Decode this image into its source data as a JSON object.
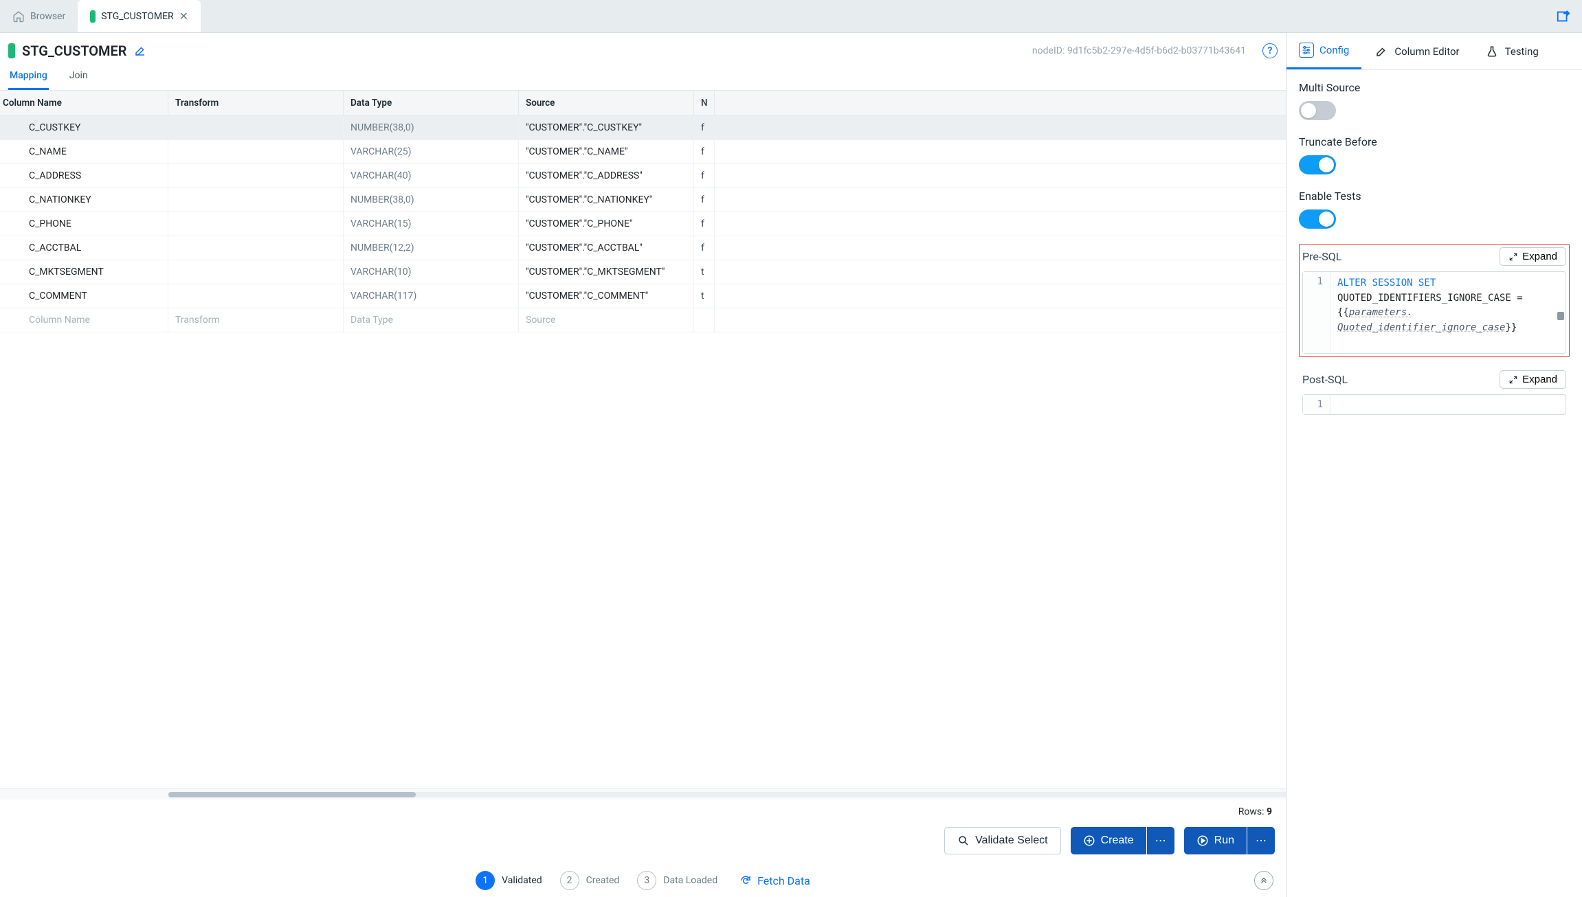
{
  "tabs": {
    "browser": "Browser",
    "node_tab": "STG_CUSTOMER"
  },
  "node": {
    "title": "STG_CUSTOMER",
    "id_label": "nodeID:",
    "id_value": "9d1fc5b2-297e-4d5f-b6d2-b03771b43641"
  },
  "subtabs": {
    "mapping": "Mapping",
    "join": "Join"
  },
  "grid": {
    "headers": {
      "name": "Column Name",
      "transform": "Transform",
      "type": "Data Type",
      "source": "Source",
      "null": "N"
    },
    "rows": [
      {
        "name": "C_CUSTKEY",
        "transform": "",
        "type": "NUMBER(38,0)",
        "source": "\"CUSTOMER\".\"C_CUSTKEY\"",
        "null": "f",
        "selected": true
      },
      {
        "name": "C_NAME",
        "transform": "",
        "type": "VARCHAR(25)",
        "source": "\"CUSTOMER\".\"C_NAME\"",
        "null": "f"
      },
      {
        "name": "C_ADDRESS",
        "transform": "",
        "type": "VARCHAR(40)",
        "source": "\"CUSTOMER\".\"C_ADDRESS\"",
        "null": "f"
      },
      {
        "name": "C_NATIONKEY",
        "transform": "",
        "type": "NUMBER(38,0)",
        "source": "\"CUSTOMER\".\"C_NATIONKEY\"",
        "null": "f"
      },
      {
        "name": "C_PHONE",
        "transform": "",
        "type": "VARCHAR(15)",
        "source": "\"CUSTOMER\".\"C_PHONE\"",
        "null": "f"
      },
      {
        "name": "C_ACCTBAL",
        "transform": "",
        "type": "NUMBER(12,2)",
        "source": "\"CUSTOMER\".\"C_ACCTBAL\"",
        "null": "f"
      },
      {
        "name": "C_MKTSEGMENT",
        "transform": "",
        "type": "VARCHAR(10)",
        "source": "\"CUSTOMER\".\"C_MKTSEGMENT\"",
        "null": "t"
      },
      {
        "name": "C_COMMENT",
        "transform": "",
        "type": "VARCHAR(117)",
        "source": "\"CUSTOMER\".\"C_COMMENT\"",
        "null": "t"
      }
    ],
    "placeholder": {
      "name": "Column Name",
      "transform": "Transform",
      "type": "Data Type",
      "source": "Source"
    }
  },
  "rows_bar": {
    "label": "Rows:",
    "count": "9"
  },
  "actions": {
    "validate": "Validate Select",
    "create": "Create",
    "run": "Run"
  },
  "status": {
    "steps": [
      {
        "num": "1",
        "label": "Validated",
        "active": true
      },
      {
        "num": "2",
        "label": "Created",
        "active": false
      },
      {
        "num": "3",
        "label": "Data Loaded",
        "active": false
      }
    ],
    "fetch": "Fetch Data"
  },
  "side_tabs": {
    "config": "Config",
    "column_editor": "Column Editor",
    "testing": "Testing"
  },
  "config": {
    "multi_source": {
      "label": "Multi Source",
      "on": false
    },
    "truncate_before": {
      "label": "Truncate Before",
      "on": true
    },
    "enable_tests": {
      "label": "Enable Tests",
      "on": true
    },
    "pre_sql": {
      "label": "Pre-SQL",
      "expand": "Expand",
      "line_no": "1",
      "kw": "ALTER SESSION SET",
      "line2": "QUOTED_IDENTIFIERS_IGNORE_CASE =",
      "param_open": "{{",
      "param_body": "parameters.\nQuoted_identifier_ignore_case",
      "param_close": "}}"
    },
    "post_sql": {
      "label": "Post-SQL",
      "expand": "Expand",
      "line_no": "1"
    }
  }
}
